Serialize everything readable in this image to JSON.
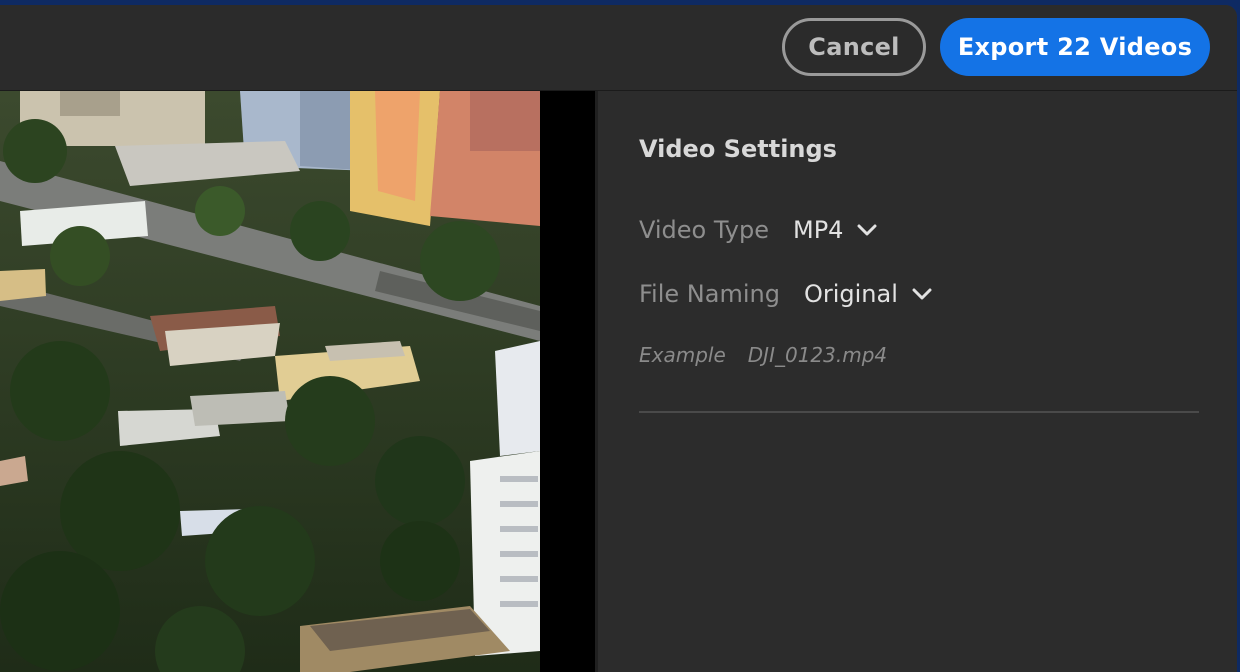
{
  "header": {
    "cancel_label": "Cancel",
    "export_label": "Export 22 Videos"
  },
  "preview": {
    "image": "aerial drone photo of city neighborhood with trees and apartment buildings"
  },
  "settings": {
    "title": "Video Settings",
    "video_type": {
      "label": "Video Type",
      "value": "MP4"
    },
    "file_naming": {
      "label": "File Naming",
      "value": "Original"
    },
    "example": {
      "label": "Example",
      "value": "DJI_0123.mp4"
    }
  },
  "colors": {
    "accent": "#1473e6",
    "panel": "#2c2c2c",
    "window_bg": "#0e2a63"
  },
  "icons": [
    "chevron-down-icon"
  ]
}
